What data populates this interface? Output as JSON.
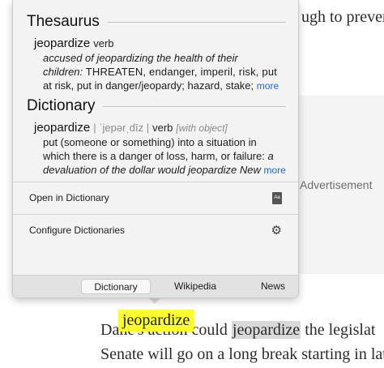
{
  "article": {
    "line1_fragment": "ugh to prever",
    "advertisement": "Advertisement",
    "line2_before": "Dan",
    "line2_highlight": "jeopardize",
    "line2_mid": " could ",
    "line2_after": " the legislat",
    "line2_obscured": "e's action",
    "line3": "Senate will go on a long break starting in lat"
  },
  "lookup_word": "jeopardize",
  "popover": {
    "thesaurus": {
      "title": "Thesaurus",
      "headword": "jeopardize",
      "pos": "verb",
      "def_line1": "accused of jeopardizing the health of their",
      "def_line2_italic": "children:",
      "def_line2_rest": " THREATEN, endanger, imperil, risk, put",
      "def_line3": "at risk, put in danger/jeopardy; hazard, stake;",
      "more": "more"
    },
    "dictionary": {
      "title": "Dictionary",
      "headword": "jeopardize",
      "pronunciation": "| ˈjepərˌdīz |",
      "pos": "verb",
      "grammar": "[with object]",
      "def_line1": "put (someone or something) into a situation in",
      "def_line2": "which there is a danger of loss, harm, or failure:",
      "def_line2_example": " a",
      "def_line3": "devaluation of the dollar would jeopardize New",
      "more": "more"
    },
    "actions": {
      "open_dictionary": "Open in Dictionary",
      "configure": "Configure Dictionaries",
      "book_icon_text": "Aa"
    },
    "tabs": [
      {
        "label": "Dictionary",
        "active": true
      },
      {
        "label": "Wikipedia",
        "active": false
      },
      {
        "label": "News",
        "active": false
      }
    ]
  },
  "colors": {
    "link": "#2167d9",
    "highlight": "#ffff2a",
    "selection": "#d9d9d9"
  }
}
